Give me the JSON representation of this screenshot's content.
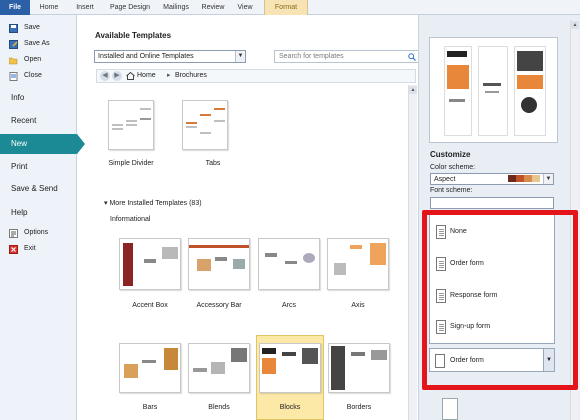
{
  "ribbon": {
    "tabs": [
      "File",
      "Home",
      "Insert",
      "Page Design",
      "Mailings",
      "Review",
      "View",
      "Format"
    ]
  },
  "nav": {
    "small_top": [
      "Save",
      "Save As",
      "Open",
      "Close"
    ],
    "big": [
      "Info",
      "Recent",
      "New",
      "Print",
      "Save & Send",
      "Help"
    ],
    "small_bottom": [
      "Options",
      "Exit"
    ],
    "active": "New"
  },
  "main": {
    "title": "Available Templates",
    "source_select": "Installed and Online Templates",
    "search_placeholder": "Search for templates",
    "breadcrumb": {
      "home": "Home",
      "current": "Brochures"
    },
    "top_templates": [
      "Simple Divider",
      "Tabs"
    ],
    "more_section": "More Installed Templates (83)",
    "group": "Informational",
    "row1": [
      "Accent Box",
      "Accessory Bar",
      "Arcs",
      "Axis"
    ],
    "row2": [
      "Bars",
      "Blends",
      "Blocks",
      "Borders"
    ],
    "selected": "Blocks"
  },
  "customize": {
    "title": "Customize",
    "color_scheme_label": "Color scheme:",
    "color_scheme_value": "Aspect",
    "swatch_colors": [
      "#1f1f1f",
      "#6b2a1a",
      "#c0522a",
      "#d88b4a",
      "#e8c48e",
      "#3d3d3d"
    ],
    "font_scheme_label": "Font scheme:",
    "dropdown_items": [
      "None",
      "Order form",
      "Response form",
      "Sign-up form"
    ],
    "dropdown_value": "Order form"
  },
  "colors": {
    "file_tab": "#2b5fa6",
    "nav_active": "#1b8a94",
    "selection": "#fce9a8",
    "highlight_box": "#e3141a"
  }
}
